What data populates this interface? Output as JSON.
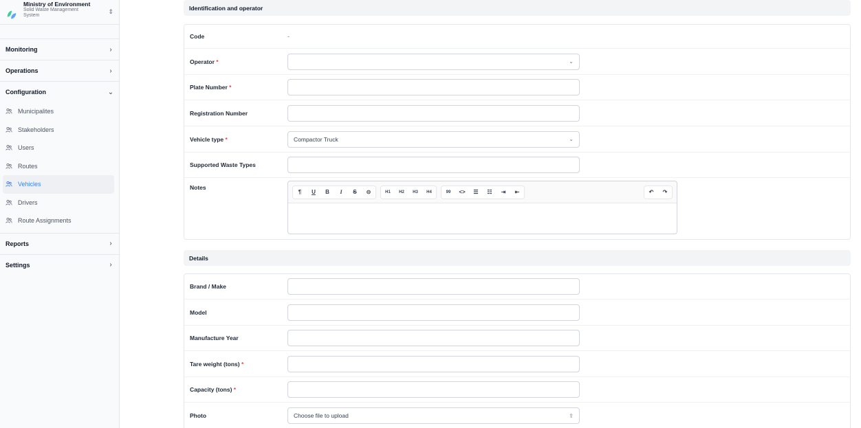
{
  "brand": {
    "title": "Ministry of Environment",
    "subtitle": "Solid Waste Management System",
    "switch_icon": "chevron-up-down-icon"
  },
  "nav": {
    "monitoring": "Monitoring",
    "operations": "Operations",
    "configuration": "Configuration",
    "items": [
      {
        "label": "Municipalites",
        "icon": "users-icon"
      },
      {
        "label": "Stakeholders",
        "icon": "users-icon"
      },
      {
        "label": "Users",
        "icon": "users-icon"
      },
      {
        "label": "Routes",
        "icon": "users-icon"
      },
      {
        "label": "Vehicles",
        "icon": "users-icon",
        "active": true
      },
      {
        "label": "Drivers",
        "icon": "users-icon"
      },
      {
        "label": "Route Assignments",
        "icon": "users-icon"
      }
    ],
    "reports": "Reports",
    "settings": "Settings"
  },
  "sections": {
    "identification": {
      "title": "Identification and operator",
      "code_label": "Code",
      "code_value": "-",
      "operator_label": "Operator",
      "operator_value": "",
      "plate_label": "Plate Number",
      "plate_value": "",
      "registration_label": "Registration Number",
      "registration_value": "",
      "vehicle_type_label": "Vehicle type",
      "vehicle_type_value": "Compactor Truck",
      "waste_types_label": "Supported Waste Types",
      "waste_types_value": "",
      "notes_label": "Notes",
      "required_mark": "*"
    },
    "details": {
      "title": "Details",
      "brand_label": "Brand / Make",
      "model_label": "Model",
      "year_label": "Manufacture Year",
      "tare_label": "Tare weight (tons)",
      "capacity_label": "Capacity (tons)",
      "photo_label": "Photo",
      "photo_placeholder": "Choose file to upload"
    }
  },
  "toolbar": {
    "paragraph": "¶",
    "underline": "U",
    "bold": "B",
    "italic": "I",
    "strike": "S",
    "link": "⊝",
    "h1": "H1",
    "h2": "H2",
    "h3": "H3",
    "h4": "H4",
    "quote": "99",
    "code": "<>",
    "bullet": "☰",
    "ordered": "☷",
    "indent": "⇥",
    "outdent": "⇤",
    "undo": "↶",
    "redo": "↷"
  },
  "colors": {
    "accent": "#3b82f6",
    "required": "#ef4444"
  }
}
